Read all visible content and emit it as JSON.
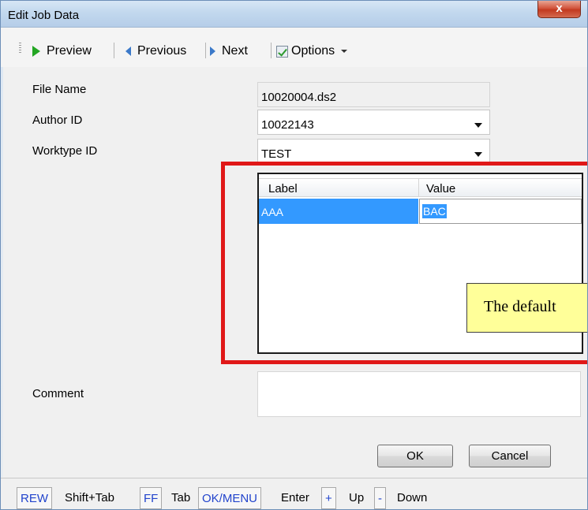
{
  "window": {
    "title": "Edit Job Data",
    "close_glyph": "x"
  },
  "toolbar": {
    "preview": "Preview",
    "previous": "Previous",
    "next": "Next",
    "options": "Options"
  },
  "form": {
    "file_name_label": "File Name",
    "file_name_value": "10020004.ds2",
    "author_id_label": "Author ID",
    "author_id_value": "10022143",
    "worktype_id_label": "Worktype ID",
    "worktype_id_value": "TEST",
    "comment_label": "Comment",
    "comment_value": ""
  },
  "grid": {
    "columns": [
      "Label",
      "Value"
    ],
    "rows": [
      {
        "label": "AAA",
        "value": "BAC"
      }
    ]
  },
  "note": {
    "text": "The default"
  },
  "buttons": {
    "ok": "OK",
    "cancel": "Cancel"
  },
  "statusbar": {
    "items": [
      {
        "key": "REW",
        "action": "Shift+Tab"
      },
      {
        "key": "FF",
        "action": "Tab"
      },
      {
        "key": "OK/MENU",
        "action": "Enter"
      },
      {
        "key": "+",
        "action": "Up"
      },
      {
        "key": "-",
        "action": "Down"
      }
    ]
  },
  "colors": {
    "highlight_box": "#e01818",
    "selection": "#3399ff",
    "note_bg": "#ffff99",
    "key_text": "#2244cc"
  },
  "icons": {
    "preview": "play-icon",
    "previous": "left-arrow-icon",
    "next": "right-arrow-icon",
    "options": "checklist-icon"
  }
}
